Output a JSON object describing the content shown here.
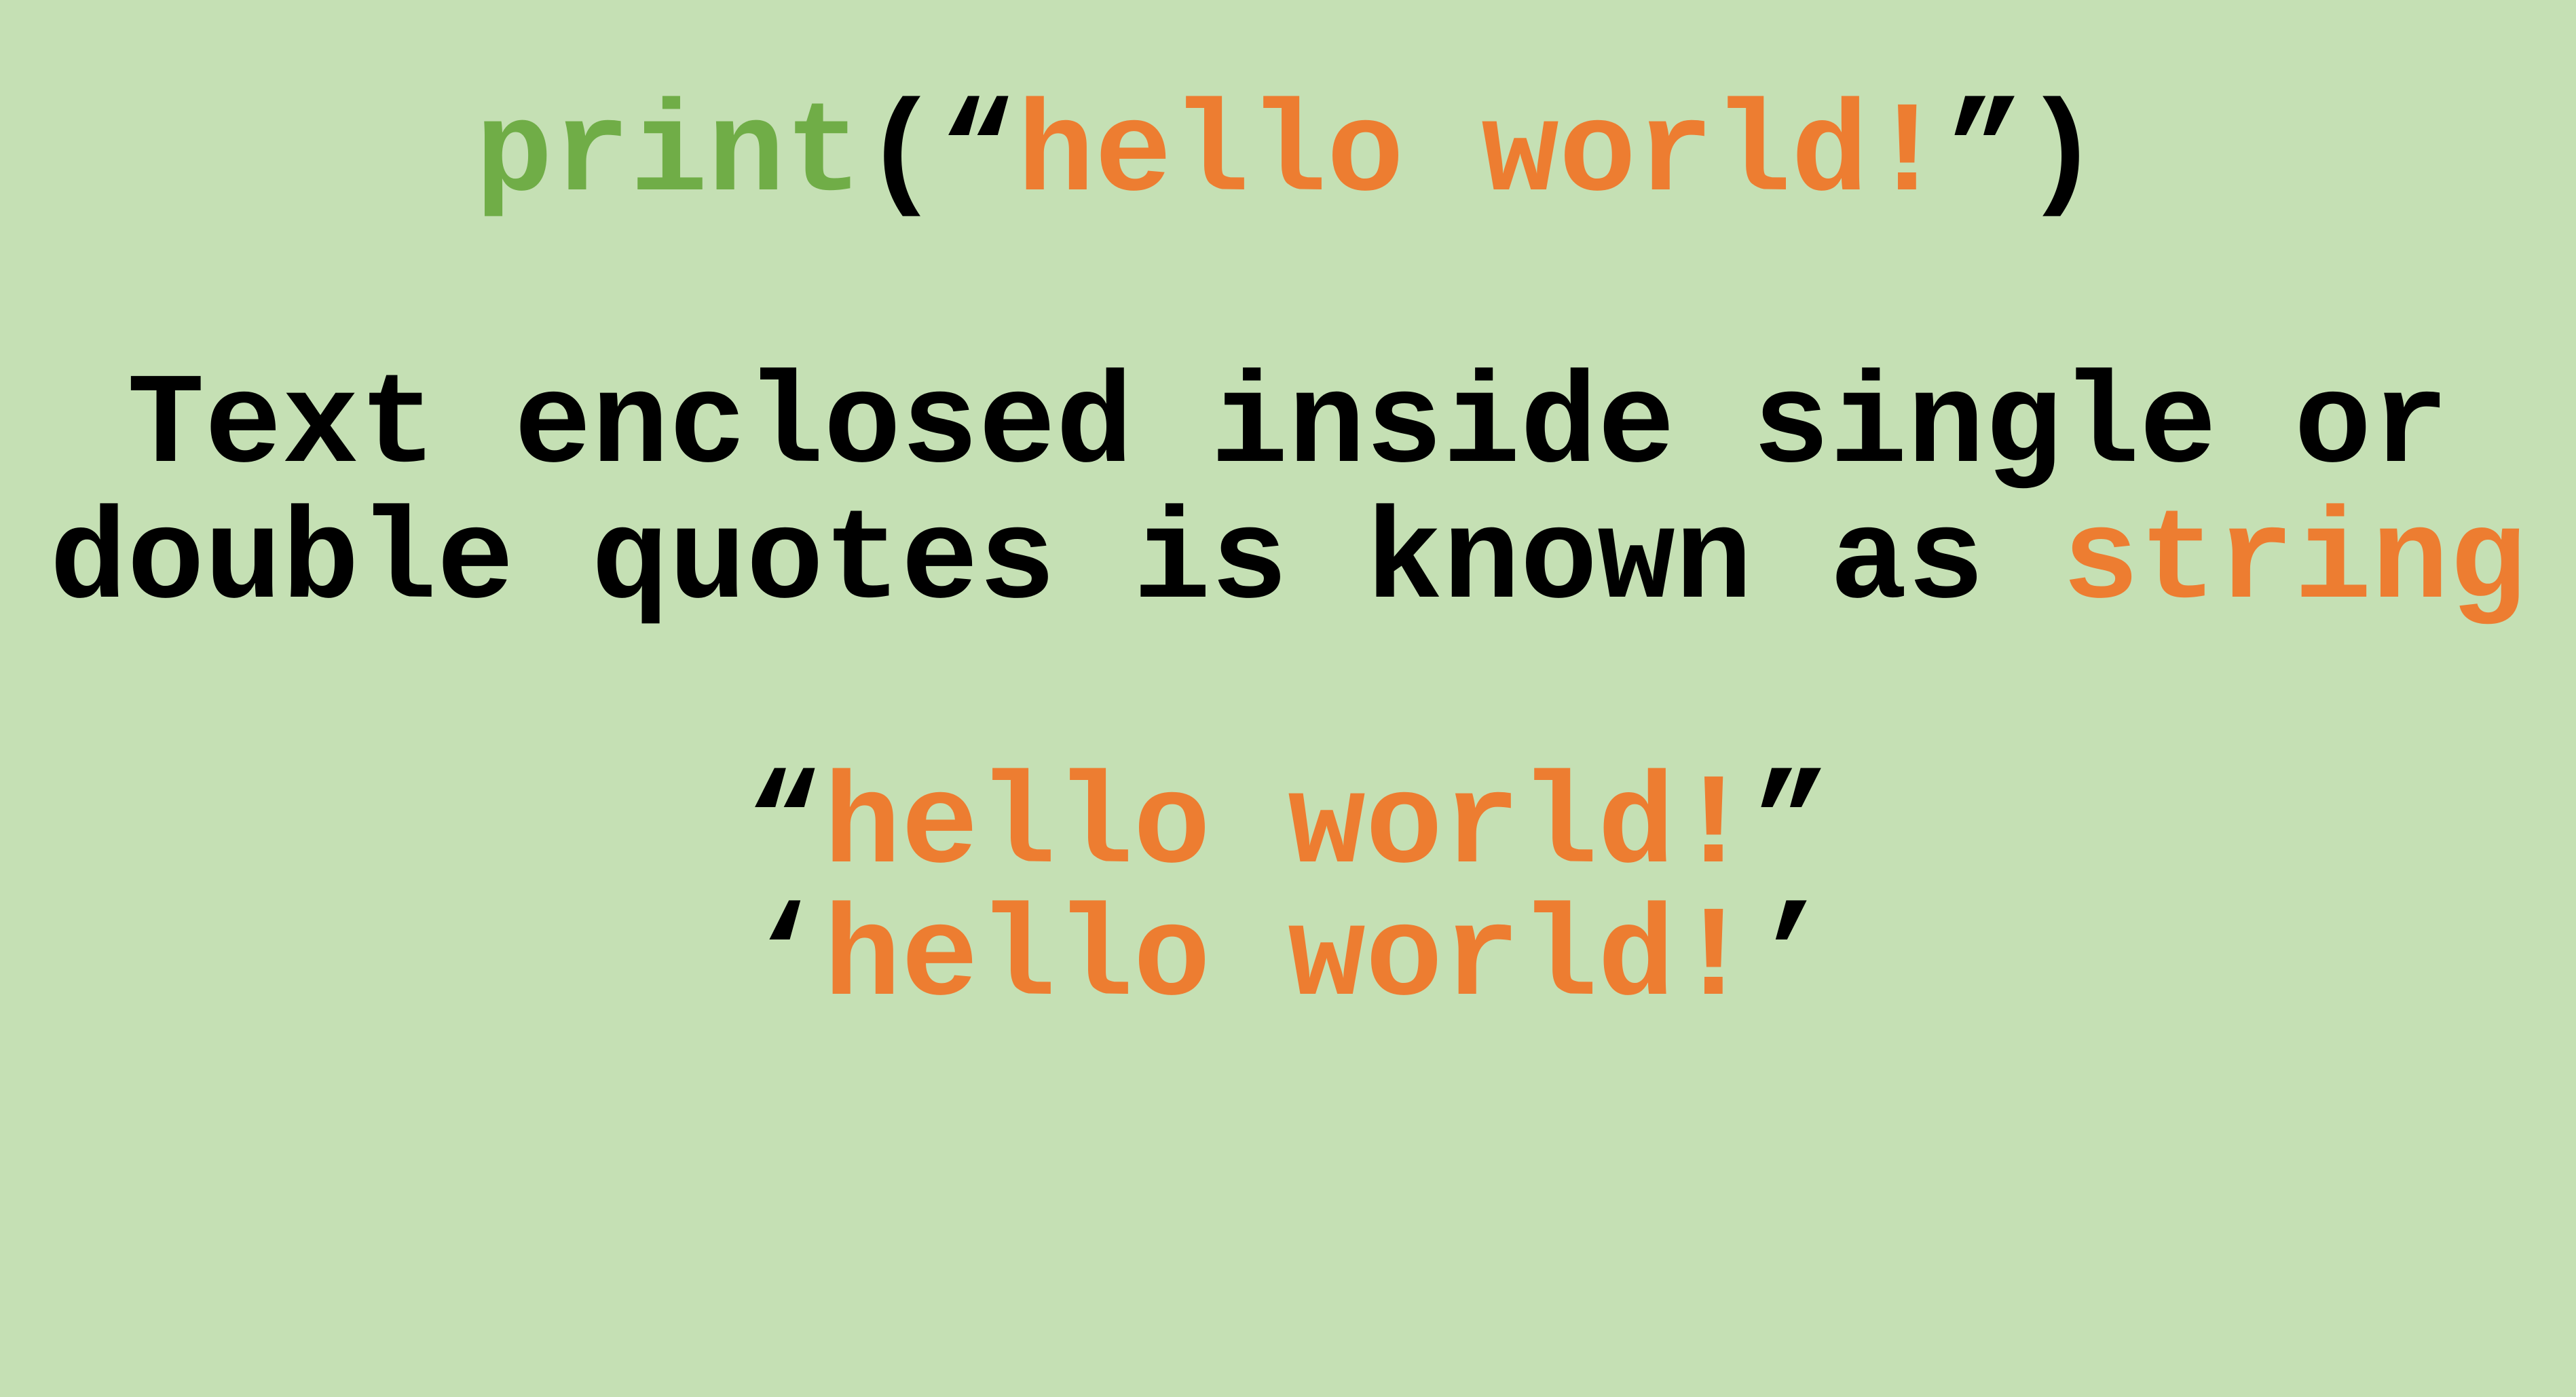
{
  "code_line": {
    "func": "print",
    "open": "(“",
    "string": "hello world!",
    "close": "”)"
  },
  "explanation": {
    "line1": "Text enclosed inside single or",
    "line2_prefix": "double quotes is known as ",
    "line2_keyword": "string"
  },
  "examples": {
    "double": {
      "open": "“",
      "text": "hello world!",
      "close": "”"
    },
    "single": {
      "open": "‘",
      "text": "hello world!",
      "close": "’"
    }
  },
  "colors": {
    "background": "#C5E0B4",
    "function": "#70AD47",
    "string": "#ED7D31",
    "text": "#000000"
  }
}
